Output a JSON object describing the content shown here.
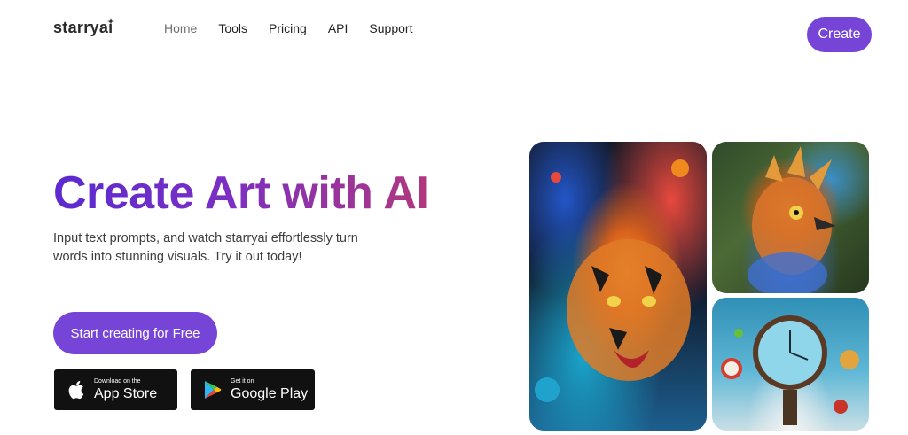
{
  "header": {
    "logo": "starryai",
    "nav": [
      {
        "label": "Home",
        "active": true
      },
      {
        "label": "Tools",
        "active": false
      },
      {
        "label": "Pricing",
        "active": false
      },
      {
        "label": "API",
        "active": false
      },
      {
        "label": "Support",
        "active": false
      }
    ],
    "create_label": "Create"
  },
  "hero": {
    "title": "Create Art with AI",
    "subtitle": "Input text prompts, and watch starryai effortlessly turn words into stunning visuals. Try it out today!",
    "cta_label": "Start creating for Free"
  },
  "stores": {
    "apple": {
      "small": "Download on the",
      "big": "App Store"
    },
    "google": {
      "small": "Get it on",
      "big": "Google Play"
    }
  },
  "colors": {
    "accent": "#7645d8",
    "title_gradient_start": "#5b2ad0",
    "title_gradient_end": "#b1377e"
  }
}
